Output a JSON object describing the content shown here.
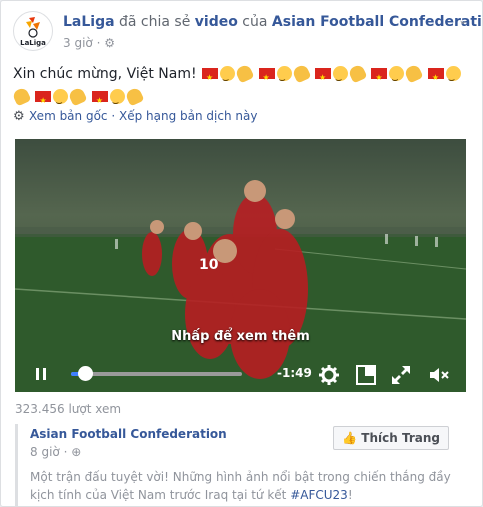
{
  "post": {
    "author": "LaLiga",
    "action": "đã chia sẻ",
    "object": "video",
    "of": "của",
    "source_page": "Asian Football Confederation.",
    "time": "3 giờ",
    "visibility_icon": "globe-icon",
    "avatar_brand": "LaLiga",
    "message_text": "Xin chúc mừng, Việt Nam!",
    "translate": {
      "see_original": "Xem bản gốc",
      "separator": "·",
      "rate": "Xếp hạng bản dịch này"
    }
  },
  "video": {
    "overlay_text": "Nhấp để xem thêm",
    "time_remaining": "-1:49",
    "progress_fraction": 0.08,
    "controls": [
      "pause-icon",
      "settings-icon",
      "pip-icon",
      "fullscreen-icon",
      "mute-icon"
    ]
  },
  "stats": {
    "views": "323.456 lượt xem"
  },
  "shared": {
    "page_name": "Asian Football Confederation",
    "time": "8 giờ",
    "like_button": "Thích Trang",
    "text_part1": "Một trận đấu tuyệt vời! Những hình ảnh nổi bật trong chiến thắng đầy kịch tính của Việt Nam trước Iraq tại tứ kết ",
    "hashtag": "#AFCU23",
    "text_end": "!"
  },
  "colors": {
    "link": "#365899",
    "muted": "#90949c",
    "progress": "#4080ff",
    "flag_red": "#da251d",
    "flag_star": "#ffde00"
  }
}
